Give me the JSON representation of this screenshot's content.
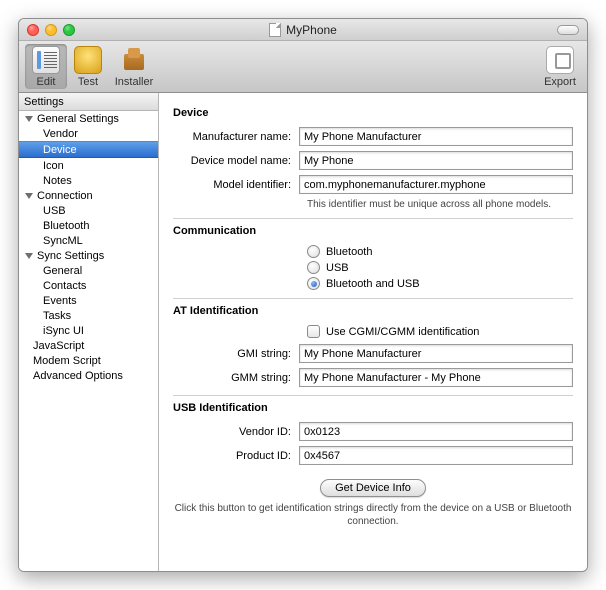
{
  "window": {
    "title": "MyPhone"
  },
  "toolbar": {
    "edit": "Edit",
    "test": "Test",
    "installer": "Installer",
    "export": "Export"
  },
  "sidebar": {
    "header": "Settings",
    "groups": [
      {
        "label": "General Settings",
        "items": [
          "Vendor",
          "Device",
          "Icon",
          "Notes"
        ],
        "selected": 1
      },
      {
        "label": "Connection",
        "items": [
          "USB",
          "Bluetooth",
          "SyncML"
        ]
      },
      {
        "label": "Sync Settings",
        "items": [
          "General",
          "Contacts",
          "Events",
          "Tasks",
          "iSync UI"
        ]
      }
    ],
    "flat": [
      "JavaScript",
      "Modem Script",
      "Advanced Options"
    ]
  },
  "sections": {
    "device": {
      "title": "Device",
      "manufacturer_label": "Manufacturer name:",
      "manufacturer_value": "My Phone Manufacturer",
      "model_label": "Device model name:",
      "model_value": "My Phone",
      "identifier_label": "Model identifier:",
      "identifier_value": "com.myphonemanufacturer.myphone",
      "identifier_hint": "This identifier must be unique across all phone models."
    },
    "communication": {
      "title": "Communication",
      "options": [
        "Bluetooth",
        "USB",
        "Bluetooth and USB"
      ],
      "selected": 2
    },
    "at": {
      "title": "AT Identification",
      "checkbox_label": "Use CGMI/CGMM identification",
      "gmi_label": "GMI string:",
      "gmi_value": "My Phone Manufacturer",
      "gmm_label": "GMM string:",
      "gmm_value": "My Phone Manufacturer - My Phone"
    },
    "usb": {
      "title": "USB Identification",
      "vendor_label": "Vendor ID:",
      "vendor_value": "0x0123",
      "product_label": "Product ID:",
      "product_value": "0x4567"
    },
    "footer": {
      "button": "Get Device Info",
      "hint": "Click this button to get identification strings directly\nfrom the device on a USB or Bluetooth connection."
    }
  }
}
